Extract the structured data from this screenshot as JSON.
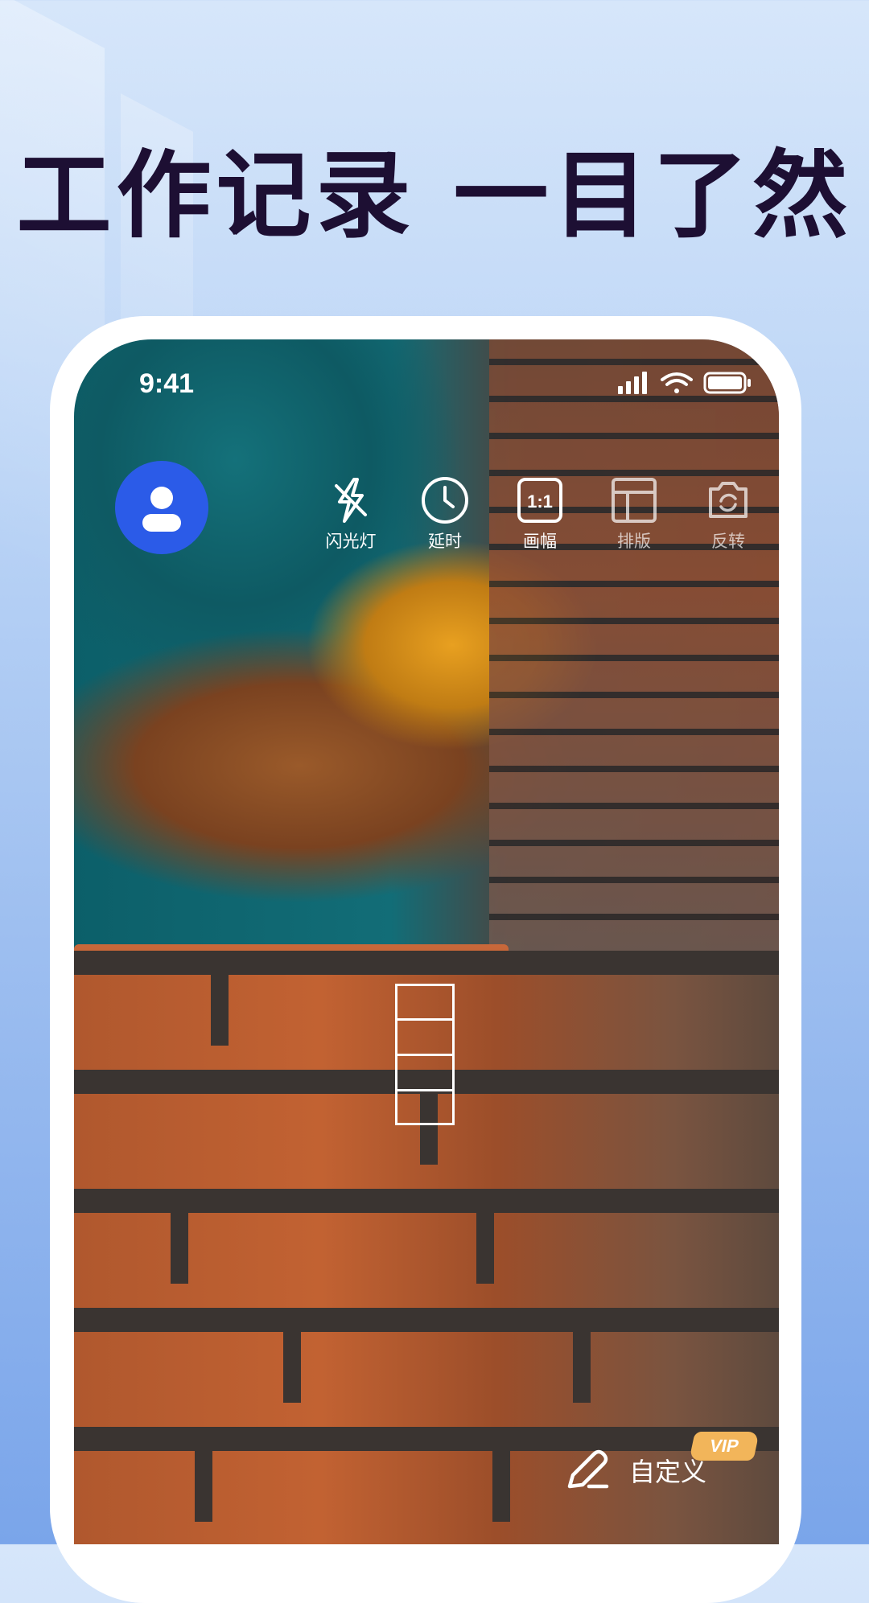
{
  "headline": "工作记录 一目了然",
  "status_bar": {
    "time": "9:41",
    "icons": [
      "cellular-signal-icon",
      "wifi-icon",
      "battery-icon"
    ]
  },
  "camera": {
    "avatar_icon": "user-avatar-icon",
    "tools": [
      {
        "label": "闪光灯",
        "icon": "flash-icon"
      },
      {
        "label": "延时",
        "icon": "timer-clock-icon"
      },
      {
        "label": "画幅",
        "icon": "aspect-ratio-1-1-icon",
        "icon_text": "1:1"
      },
      {
        "label": "排版",
        "icon": "layout-icon"
      },
      {
        "label": "反转",
        "icon": "flip-camera-icon"
      }
    ],
    "custom_button": {
      "label": "自定义",
      "icon": "pen-icon",
      "badge": "VIP"
    }
  },
  "colors": {
    "headline": "#1d0f33",
    "avatar_bg": "#2b5be8",
    "vip_badge": "#f2b55a",
    "background_top": "#d6e6fa",
    "background_bottom": "#7aa5ea"
  }
}
